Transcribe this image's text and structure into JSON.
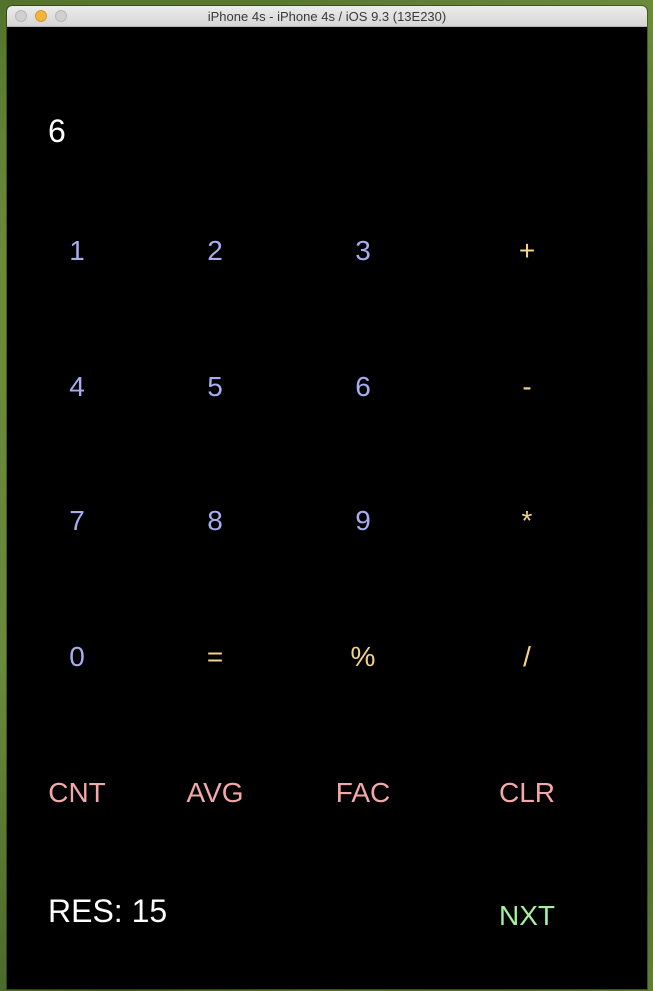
{
  "window": {
    "title": "iPhone 4s - iPhone 4s / iOS 9.3 (13E230)"
  },
  "display": {
    "value": "6"
  },
  "keypad": {
    "row1": [
      "1",
      "2",
      "3",
      "+"
    ],
    "row2": [
      "4",
      "5",
      "6",
      "-"
    ],
    "row3": [
      "7",
      "8",
      "9",
      "*"
    ],
    "row4": [
      "0",
      "=",
      "%",
      "/"
    ],
    "functions": [
      "CNT",
      "AVG",
      "FAC",
      "CLR"
    ]
  },
  "result": {
    "label": "RES: 15"
  },
  "next_button": {
    "label": "NXT"
  },
  "colors": {
    "background": "#000000",
    "digit": "#a6acf0",
    "operator": "#f2d58a",
    "function": "#f2a8a8",
    "next": "#a4f0a0",
    "display_text": "#ffffff"
  }
}
